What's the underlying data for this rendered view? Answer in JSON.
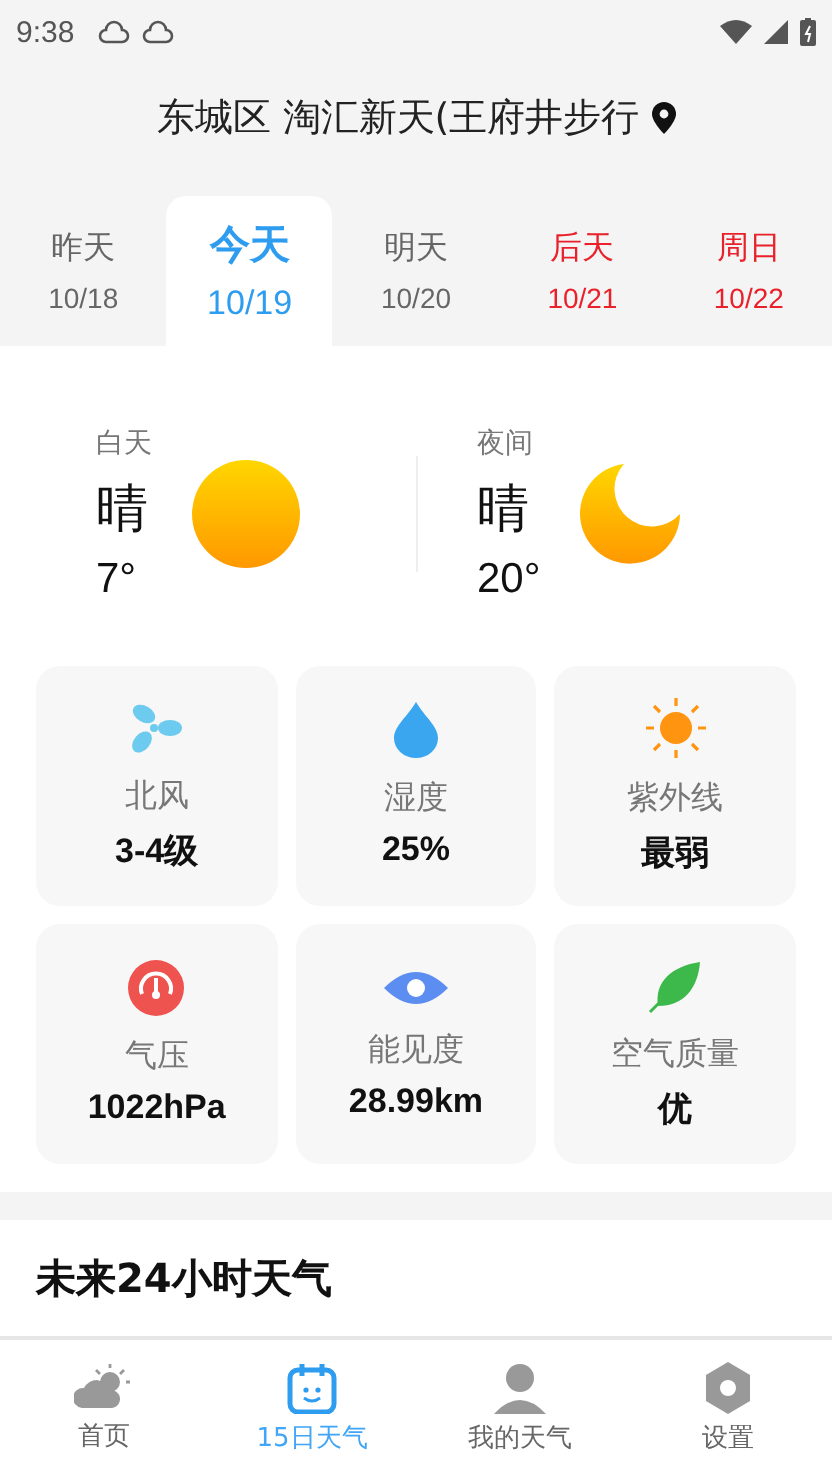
{
  "status_bar": {
    "time": "9:38"
  },
  "location": {
    "title": "东城区 淘汇新天(王府井步行"
  },
  "days": [
    {
      "label": "昨天",
      "date": "10/18",
      "selected": false,
      "weekend": false
    },
    {
      "label": "今天",
      "date": "10/19",
      "selected": true,
      "weekend": false
    },
    {
      "label": "明天",
      "date": "10/20",
      "selected": false,
      "weekend": false
    },
    {
      "label": "后天",
      "date": "10/21",
      "selected": false,
      "weekend": true
    },
    {
      "label": "周日",
      "date": "10/22",
      "selected": false,
      "weekend": true
    }
  ],
  "periods": [
    {
      "kind": "day",
      "label": "白天",
      "condition": "晴",
      "temp": "7°"
    },
    {
      "kind": "night",
      "label": "夜间",
      "condition": "晴",
      "temp": "20°"
    }
  ],
  "metrics": [
    {
      "kind": "wind",
      "label": "北风",
      "value": "3-4级"
    },
    {
      "kind": "humidity",
      "label": "湿度",
      "value": "25%"
    },
    {
      "kind": "uv",
      "label": "紫外线",
      "value": "最弱"
    },
    {
      "kind": "pressure",
      "label": "气压",
      "value": "1022hPa"
    },
    {
      "kind": "visibility",
      "label": "能见度",
      "value": "28.99km"
    },
    {
      "kind": "air",
      "label": "空气质量",
      "value": "优"
    }
  ],
  "section": {
    "title": "未来24小时天气"
  },
  "nav": [
    {
      "kind": "home",
      "label": "首页",
      "selected": false
    },
    {
      "kind": "calendar",
      "label": "15日天气",
      "selected": true
    },
    {
      "kind": "person",
      "label": "我的天气",
      "selected": false
    },
    {
      "kind": "settings",
      "label": "设置",
      "selected": false
    }
  ]
}
